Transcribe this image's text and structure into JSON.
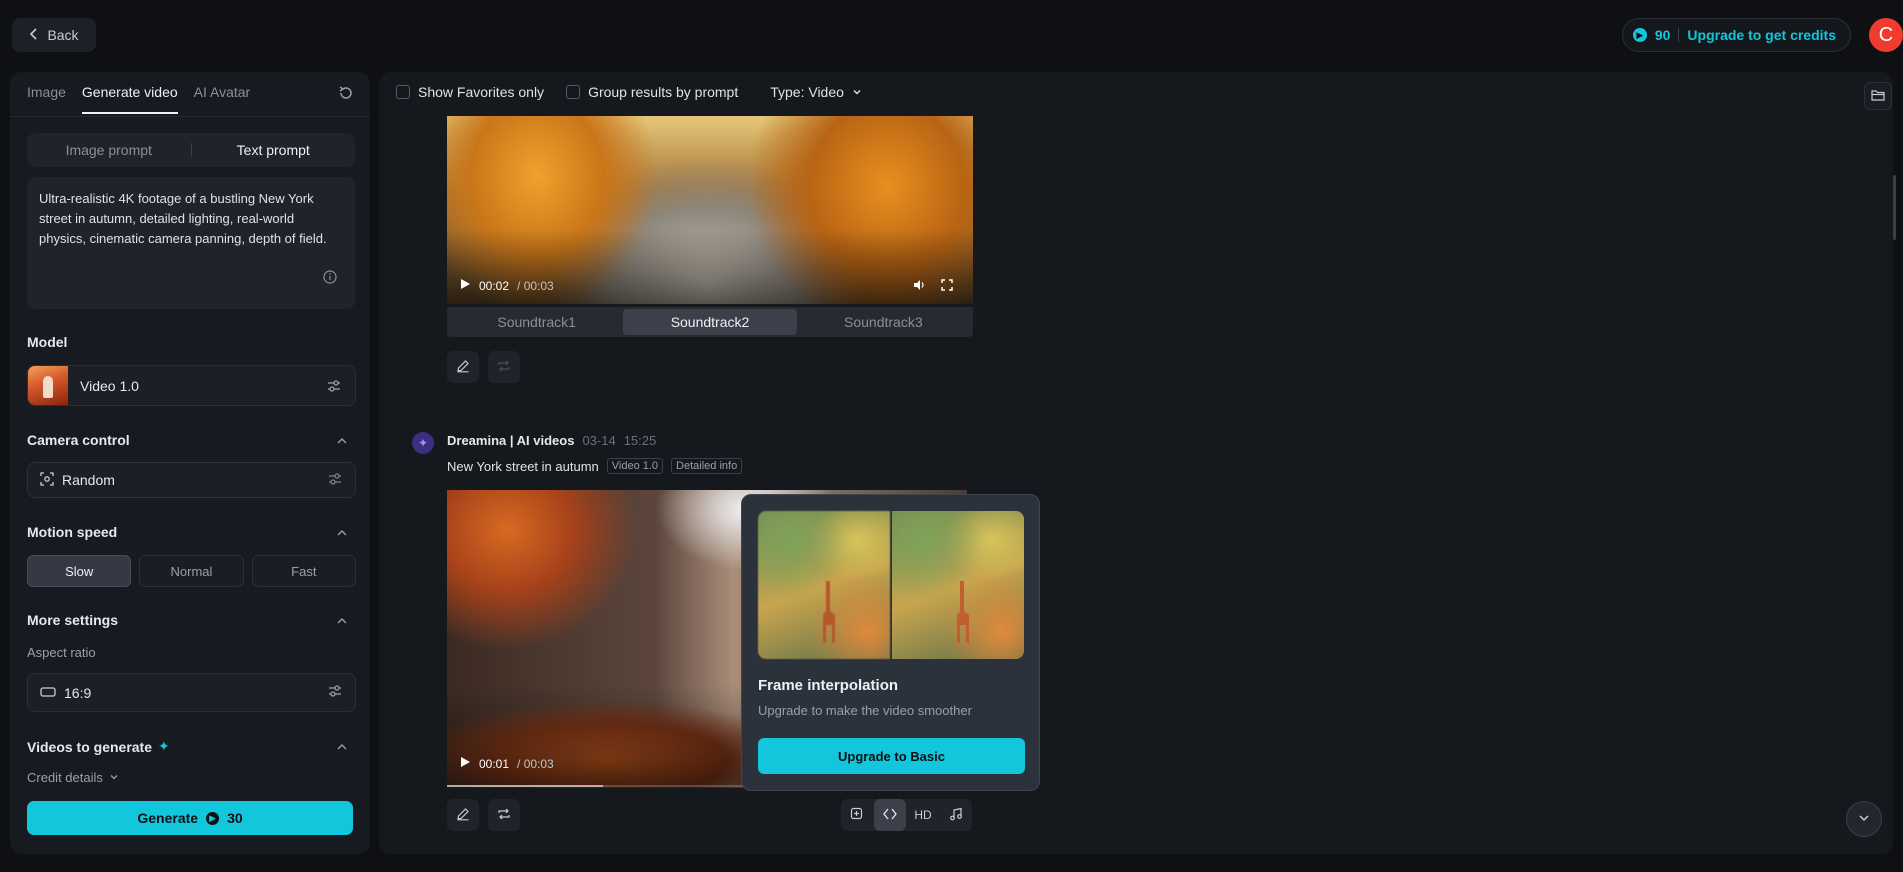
{
  "topbar": {
    "back_label": "Back",
    "credits": "90",
    "upgrade_label": "Upgrade to get credits",
    "avatar_initial": "C"
  },
  "left": {
    "tabs": [
      {
        "label": "Image"
      },
      {
        "label": "Generate video"
      },
      {
        "label": "AI Avatar"
      }
    ],
    "prompt_modes": [
      "Image prompt",
      "Text prompt"
    ],
    "prompt_text_lines": [
      "Ultra-realistic 4K footage of a bustling New York",
      "street in autumn, detailed lighting, real-world",
      "physics, cinematic camera panning, depth of field."
    ],
    "model": {
      "label": "Model",
      "value": "Video 1.0"
    },
    "camera": {
      "label": "Camera control",
      "value": "Random"
    },
    "motion": {
      "label": "Motion speed",
      "options": [
        "Slow",
        "Normal",
        "Fast"
      ],
      "selected": "Slow"
    },
    "more": {
      "label": "More settings",
      "aspect_label": "Aspect ratio",
      "aspect_value": "16:9"
    },
    "videos_to_generate": {
      "label": "Videos to generate",
      "credit_details": "Credit details"
    },
    "generate": {
      "label": "Generate",
      "cost": "30"
    }
  },
  "main": {
    "filters": {
      "favorites": "Show Favorites only",
      "group": "Group results by prompt",
      "type": "Type: Video"
    },
    "video1": {
      "time_current": "00:02",
      "time_total": "/ 00:03",
      "soundtracks": [
        "Soundtrack1",
        "Soundtrack2",
        "Soundtrack3"
      ],
      "selected_soundtrack": "Soundtrack2"
    },
    "entry2": {
      "title": "Dreamina | AI videos",
      "date": "03-14",
      "time": "15:25",
      "prompt": "New York street in autumn",
      "tag_model": "Video 1.0",
      "tag_info": "Detailed info",
      "time_current": "00:01",
      "time_total": "/ 00:03",
      "progress": 0.3,
      "hd_label": "HD"
    },
    "popover": {
      "title": "Frame interpolation",
      "subtitle": "Upgrade to make the video smoother",
      "button": "Upgrade to Basic"
    }
  },
  "colors": {
    "accent": "#12c6dc",
    "avatar": "#f03c2e",
    "background": "#0e1014"
  }
}
